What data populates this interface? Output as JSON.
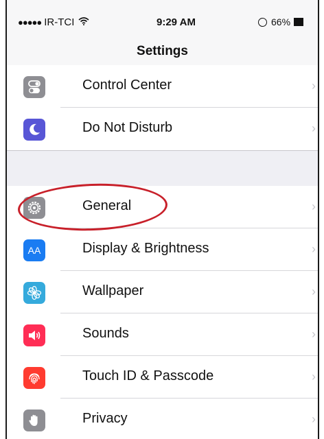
{
  "status_bar": {
    "signal_dots": "●●●●●",
    "carrier": "IR-TCI",
    "time": "9:29 AM",
    "battery": "66%"
  },
  "nav": {
    "title": "Settings"
  },
  "settings": [
    {
      "label": "Control Center",
      "icon": "switches-icon",
      "color": "#8e8e93"
    },
    {
      "label": "Do Not Disturb",
      "icon": "moon-icon",
      "color": "#5856d6"
    },
    {
      "label": "General",
      "icon": "gear-icon",
      "color": "#8e8e93"
    },
    {
      "label": "Display & Brightness",
      "icon": "aa-icon",
      "color": "#1a7cf2",
      "icon_text": "AA"
    },
    {
      "label": "Wallpaper",
      "icon": "flower-icon",
      "color": "#35aadc"
    },
    {
      "label": "Sounds",
      "icon": "speaker-icon",
      "color": "#ff2d55"
    },
    {
      "label": "Touch ID & Passcode",
      "icon": "fingerprint-icon",
      "color": "#ff3b30"
    },
    {
      "label": "Privacy",
      "icon": "hand-icon",
      "color": "#8e8e93"
    }
  ],
  "colors": {
    "highlight": "#c8202a",
    "background": "#efeff4"
  }
}
